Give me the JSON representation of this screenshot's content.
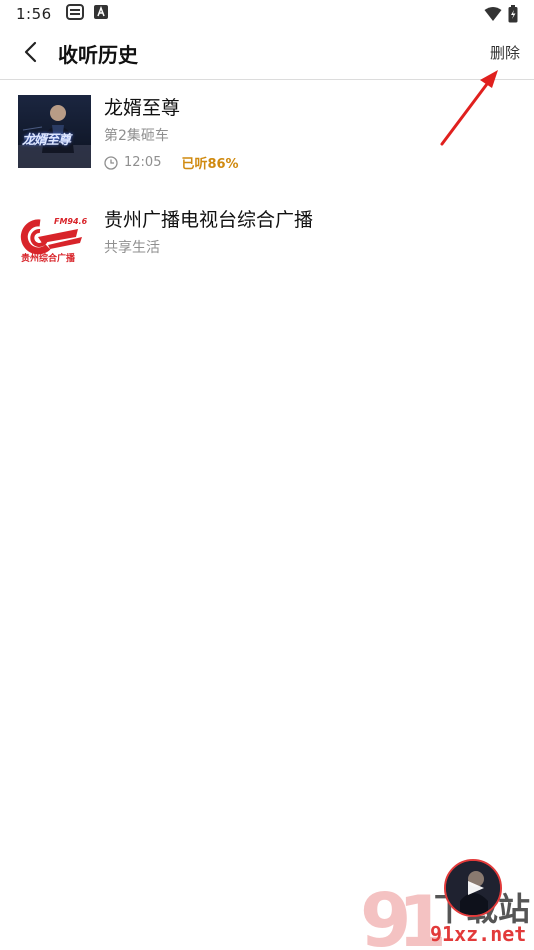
{
  "status_bar": {
    "time": "1:56",
    "left_icons": [
      "keyboard-icon",
      "a-notification-icon"
    ],
    "right_icons": [
      "wifi-icon",
      "battery-icon"
    ]
  },
  "header": {
    "title": "收听历史",
    "delete_label": "删除"
  },
  "history": [
    {
      "title": "龙婿至尊",
      "subtitle": "第2集砸车",
      "duration": "12:05",
      "progress_label": "已听86%",
      "cover_text": "龙婿至尊"
    },
    {
      "title": "贵州广播电视台综合广播",
      "subtitle": "共享生活",
      "logo_text_top": "FM94.6",
      "logo_text_bottom": "贵州综合广播"
    }
  ],
  "watermark": {
    "text": "下载站",
    "url_text": "91xz.net"
  },
  "colors": {
    "accent_progress": "#d08a10",
    "brand_red": "#d8242a",
    "divider": "#dcdcdc"
  }
}
